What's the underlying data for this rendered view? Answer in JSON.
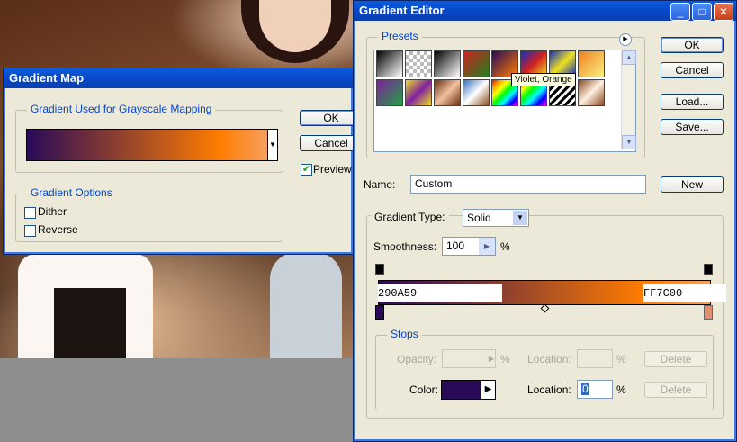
{
  "colors": {
    "xp_blue": "#0a3fb0",
    "group_label": "#0046d5",
    "gradient_start": "#290A59",
    "gradient_end": "#FF7C00"
  },
  "gradient_map": {
    "title": "Gradient Map",
    "section_mapping": "Gradient Used for Grayscale Mapping",
    "section_options": "Gradient Options",
    "ok": "OK",
    "cancel": "Cancel",
    "preview": "Preview",
    "dither": "Dither",
    "reverse": "Reverse",
    "dropdown_icon": "triangle-down-icon"
  },
  "gradient_editor": {
    "title": "Gradient Editor",
    "presets_label": "Presets",
    "tooltip": "Violet, Orange",
    "ok": "OK",
    "cancel": "Cancel",
    "load": "Load...",
    "save": "Save...",
    "name_label": "Name:",
    "name_value": "Custom",
    "new": "New",
    "gradient_type_label": "Gradient Type:",
    "gradient_type_value": "Solid",
    "smoothness_label": "Smoothness:",
    "smoothness_value": "100",
    "percent": "%",
    "left_color_code": "290A59",
    "right_color_code": "FF7C00",
    "stops_label": "Stops",
    "opacity_label": "Opacity:",
    "location_label": "Location:",
    "color_label": "Color:",
    "delete": "Delete",
    "color_location_value": "0",
    "window_buttons": {
      "minimize": "_",
      "maximize": "□",
      "close": "✕"
    }
  }
}
